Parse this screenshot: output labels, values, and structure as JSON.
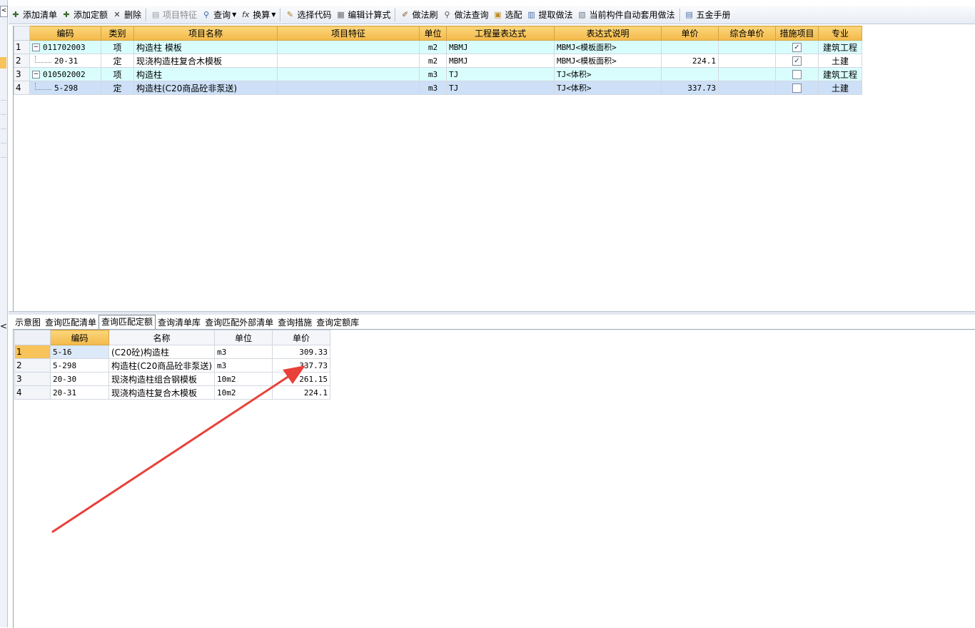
{
  "toolbar": {
    "add_list": "添加清单",
    "add_quota": "添加定额",
    "delete": "删除",
    "item_features": "项目特征",
    "query": "查询",
    "convert": "换算",
    "select_code": "选择代码",
    "edit_formula": "编辑计算式",
    "method_brush": "做法刷",
    "method_query": "做法查询",
    "match": "选配",
    "extract_method": "提取做法",
    "auto_apply": "当前构件自动套用做法",
    "hardware_manual": "五金手册"
  },
  "main_table": {
    "headers": [
      "编码",
      "类别",
      "项目名称",
      "项目特征",
      "单位",
      "工程量表达式",
      "表达式说明",
      "单价",
      "综合单价",
      "措施项目",
      "专业"
    ],
    "rows": [
      {
        "num": "1",
        "code": "011702003",
        "type": "项",
        "name": "构造柱 模板",
        "features": "",
        "unit": "m2",
        "expr": "MBMJ",
        "expr_desc": "MBMJ<模板面积>",
        "price": "",
        "comp_price": "",
        "measure_checked": true,
        "specialty": "建筑工程"
      },
      {
        "num": "2",
        "code": "20-31",
        "type": "定",
        "name": "现浇构造柱复合木模板",
        "features": "",
        "unit": "m2",
        "expr": "MBMJ",
        "expr_desc": "MBMJ<模板面积>",
        "price": "224.1",
        "comp_price": "",
        "measure_checked": true,
        "specialty": "土建"
      },
      {
        "num": "3",
        "code": "010502002",
        "type": "项",
        "name": "构造柱",
        "features": "",
        "unit": "m3",
        "expr": "TJ",
        "expr_desc": "TJ<体积>",
        "price": "",
        "comp_price": "",
        "measure_checked": false,
        "specialty": "建筑工程"
      },
      {
        "num": "4",
        "code": "5-298",
        "type": "定",
        "name": "构造柱(C20商品砼非泵送)",
        "features": "",
        "unit": "m3",
        "expr": "TJ",
        "expr_desc": "TJ<体积>",
        "price": "337.73",
        "comp_price": "",
        "measure_checked": false,
        "specialty": "土建"
      }
    ]
  },
  "tabs": [
    "示意图",
    "查询匹配清单",
    "查询匹配定额",
    "查询清单库",
    "查询匹配外部清单",
    "查询措施",
    "查询定额库"
  ],
  "active_tab": "查询匹配定额",
  "lower_table": {
    "headers": [
      "编码",
      "名称",
      "单位",
      "单价"
    ],
    "rows": [
      {
        "num": "1",
        "code": "5-16",
        "name": "(C20砼)构造柱",
        "unit": "m3",
        "price": "309.33"
      },
      {
        "num": "2",
        "code": "5-298",
        "name": "构造柱(C20商品砼非泵送)",
        "unit": "m3",
        "price": "337.73"
      },
      {
        "num": "3",
        "code": "20-30",
        "name": "现浇构造柱组合钢模板",
        "unit": "10m2",
        "price": "261.15"
      },
      {
        "num": "4",
        "code": "20-31",
        "name": "现浇构造柱复合木模板",
        "unit": "10m2",
        "price": "224.1"
      }
    ]
  },
  "colors": {
    "header_orange": "#f3b94a",
    "item_row": "#d9fdfd",
    "selected_row": "#cde0f7",
    "annotation_arrow": "#e8413a"
  }
}
